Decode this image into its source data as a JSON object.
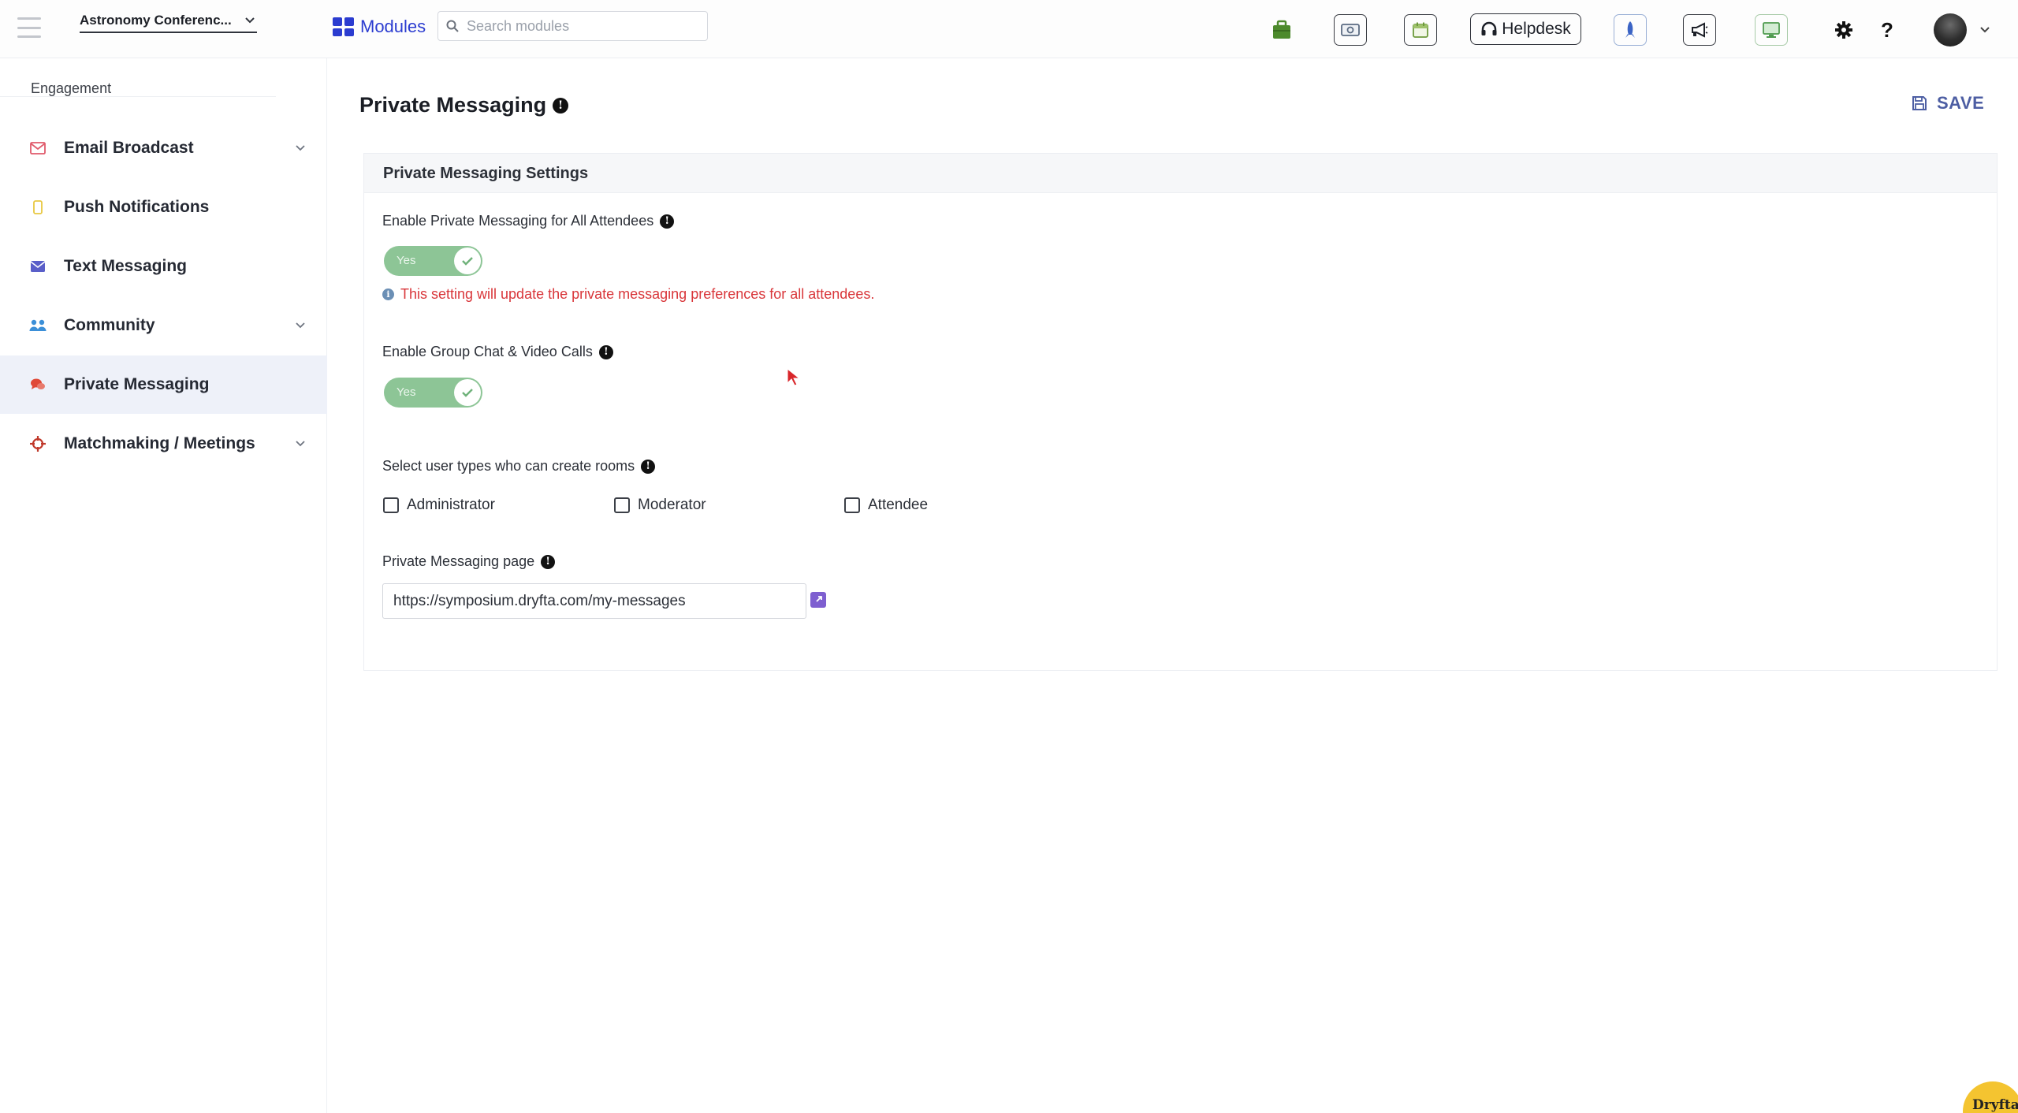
{
  "topbar": {
    "event_name": "Astronomy Conferenc...",
    "modules_label": "Modules",
    "search_placeholder": "Search modules",
    "helpdesk_label": "Helpdesk",
    "icons": [
      "briefcase-icon",
      "money-icon",
      "calendar-icon",
      "headset-icon",
      "rocket-icon",
      "megaphone-icon",
      "monitor-icon",
      "gear-icon",
      "help-icon"
    ],
    "help_label": "?"
  },
  "sidebar": {
    "section": "Engagement",
    "items": [
      {
        "label": "Email Broadcast",
        "icon": "envelope-icon",
        "color": "#e05a6b",
        "has_children": true
      },
      {
        "label": "Push Notifications",
        "icon": "mobile-icon",
        "color": "#e8c842",
        "has_children": false
      },
      {
        "label": "Text Messaging",
        "icon": "message-icon",
        "color": "#5a5fc9",
        "has_children": false
      },
      {
        "label": "Community",
        "icon": "users-icon",
        "color": "#3b8fd8",
        "has_children": true
      },
      {
        "label": "Private Messaging",
        "icon": "chat-bubbles-icon",
        "color": "#e04836",
        "has_children": false,
        "active": true
      },
      {
        "label": "Matchmaking / Meetings",
        "icon": "crosshair-icon",
        "color": "#c0392b",
        "has_children": true
      }
    ]
  },
  "main": {
    "title": "Private Messaging",
    "save_label": "SAVE",
    "card_title": "Private Messaging Settings",
    "enable_pm": {
      "label": "Enable Private Messaging for All Attendees",
      "value": "Yes",
      "warning": "This setting will update the private messaging preferences for all attendees."
    },
    "enable_group": {
      "label": "Enable Group Chat & Video Calls",
      "value": "Yes"
    },
    "room_creators": {
      "label": "Select user types who can create rooms",
      "options": [
        {
          "label": "Administrator",
          "checked": false
        },
        {
          "label": "Moderator",
          "checked": false
        },
        {
          "label": "Attendee",
          "checked": false
        }
      ]
    },
    "pm_page": {
      "label": "Private Messaging page",
      "value": "https://symposium.dryfta.com/my-messages"
    }
  },
  "brand": "Dryfta",
  "colors": {
    "accent": "#2b3cd0",
    "toggle_on": "#8dc596",
    "warning": "#d9363a",
    "save": "#4d5ea3",
    "active_nav_bg": "#eef1f9"
  }
}
